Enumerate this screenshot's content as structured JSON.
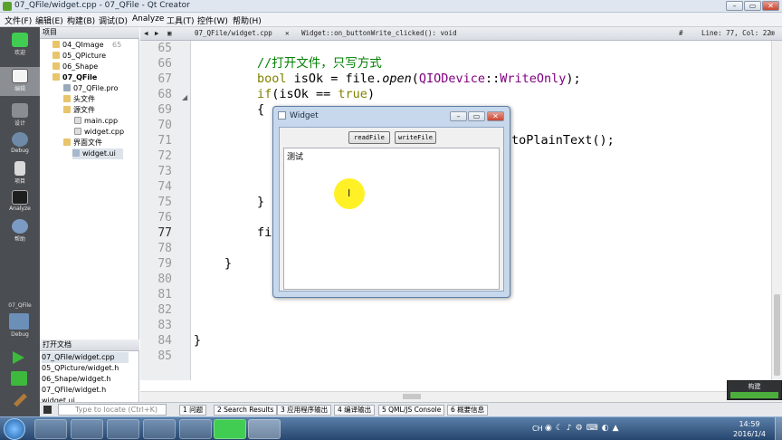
{
  "window": {
    "title": "07_QFile/widget.cpp - 07_QFile - Qt Creator"
  },
  "menu": [
    "文件(F)",
    "编辑(E)",
    "构建(B)",
    "调试(D)",
    "Analyze",
    "工具(T)",
    "控件(W)",
    "帮助(H)"
  ],
  "modes": [
    {
      "label": "欢迎",
      "icon": "qt-logo-icon"
    },
    {
      "label": "编辑",
      "icon": "edit-icon"
    },
    {
      "label": "设计",
      "icon": "design-icon"
    },
    {
      "label": "Debug",
      "icon": "debug-icon"
    },
    {
      "label": "项目",
      "icon": "projects-icon"
    },
    {
      "label": "Analyze",
      "icon": "analyze-icon"
    },
    {
      "label": "帮助",
      "icon": "help-icon"
    }
  ],
  "kit": {
    "project": "07_QFile",
    "config": "Debug"
  },
  "build_label": "构建",
  "project_panel": {
    "title": "项目",
    "items": [
      {
        "text": "65",
        "indent": 0
      },
      {
        "text": "04_QImage",
        "indent": 1
      },
      {
        "text": "05_QPicture",
        "indent": 1
      },
      {
        "text": "06_Shape",
        "indent": 1
      },
      {
        "text": "07_QFile",
        "indent": 1
      },
      {
        "text": "07_QFile.pro",
        "indent": 2
      },
      {
        "text": "头文件",
        "indent": 2
      },
      {
        "text": "源文件",
        "indent": 2
      },
      {
        "text": "main.cpp",
        "indent": 3
      },
      {
        "text": "widget.cpp",
        "indent": 3
      },
      {
        "text": "界面文件",
        "indent": 2
      },
      {
        "text": "widget.ui",
        "indent": 3
      }
    ]
  },
  "open_docs": {
    "title": "打开文档",
    "items": [
      "07_QFile/widget.cpp",
      "05_QPicture/widget.h",
      "06_Shape/widget.h",
      "07_QFile/widget.h",
      "widget.ui"
    ]
  },
  "editor": {
    "file": "07_QFile/widget.cpp",
    "symbol": "Widget::on_buttonWrite_clicked(): void",
    "encoding": "#",
    "position": "Line: 77, Col: 22",
    "line_numbers": [
      "65",
      "66",
      "67",
      "68",
      "69",
      "70",
      "71",
      "72",
      "73",
      "74",
      "75",
      "76",
      "77",
      "78",
      "79",
      "80",
      "81",
      "82",
      "83",
      "84",
      "85"
    ],
    "current_line": "77",
    "code": {
      "l66": "//打开文件，只写方式",
      "l67_kw": "bool",
      "l67_a": " isOk = file.",
      "l67_fn": "open",
      "l67_b": "(",
      "l67_ty": "QIODevice",
      "l67_c": "::",
      "l67_en": "WriteOnly",
      "l67_d": ");",
      "l68_kw": "if",
      "l68_a": "(isOk == ",
      "l68_kw2": "true",
      "l68_b": ")",
      "l69": "{",
      "l71_tail": "toPlainText();",
      "l75": "}",
      "l77": "fi",
      "l79": "}",
      "l84": "}"
    }
  },
  "widget_window": {
    "title": "Widget",
    "read_button": "readFile",
    "write_button": "writeFile",
    "text_content": "测试"
  },
  "output_tabs": [
    "1 问题",
    "2 Search Results",
    "3 应用程序输出",
    "4 编译输出",
    "5 QML/JS Console",
    "6 概要信息"
  ],
  "locator_placeholder": "Type to locate (Ctrl+K)",
  "clock": {
    "time": "14:59",
    "date": "2016/1/4"
  },
  "tray_lang": "CH"
}
